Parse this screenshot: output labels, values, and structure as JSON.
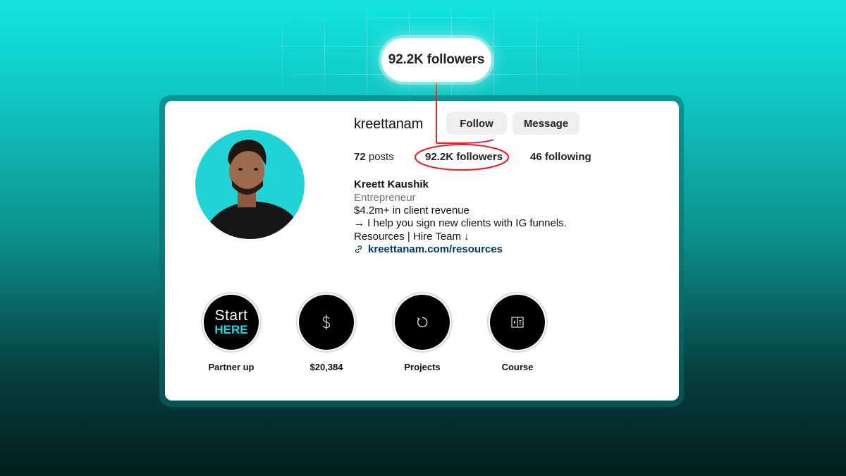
{
  "callout": {
    "text": "92.2K followers"
  },
  "profile": {
    "username": "kreettanam",
    "follow_label": "Follow",
    "message_label": "Message",
    "stats": {
      "posts_count": "72",
      "posts_label": "posts",
      "followers_count": "92.2K",
      "followers_label": "followers",
      "following_count": "46",
      "following_label": "following"
    },
    "bio": {
      "name": "Kreett Kaushik",
      "category": "Entrepreneur",
      "line1": "$4.2m+ in client revenue",
      "line2": "→ I help you sign new clients with IG funnels.",
      "line3": "Resources | Hire Team ↓",
      "link": "kreettanam.com/resources"
    }
  },
  "highlights": [
    {
      "label": "Partner up",
      "cover_top": "Start",
      "cover_bottom": "HERE",
      "icon": "start-here-cover"
    },
    {
      "label": "$20,384",
      "icon": "dollar-icon"
    },
    {
      "label": "Projects",
      "icon": "refresh-icon"
    },
    {
      "label": "Course",
      "icon": "book-icon"
    }
  ],
  "colors": {
    "accent_annotation": "#e0202a",
    "link": "#00376b",
    "avatar_bg": "#1fd3d6",
    "highlight_accent": "#1fd9e0"
  }
}
